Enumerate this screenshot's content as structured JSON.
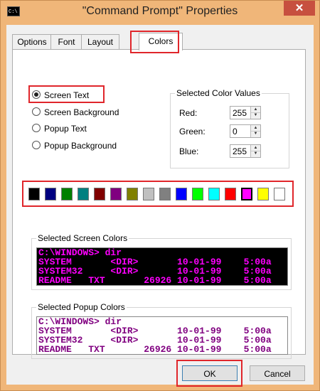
{
  "window": {
    "title": "\"Command Prompt\" Properties",
    "icon_text": "C:\\",
    "close_symbol": "✕"
  },
  "tabs": [
    {
      "label": "Options",
      "active": false
    },
    {
      "label": "Font",
      "active": false
    },
    {
      "label": "Layout",
      "active": false
    },
    {
      "label": "Colors",
      "active": true
    }
  ],
  "color_targets": {
    "selected": "Screen Text",
    "options": [
      "Screen Text",
      "Screen Background",
      "Popup Text",
      "Popup Background"
    ]
  },
  "selected_color_values": {
    "group_title": "Selected Color Values",
    "red_label": "Red:",
    "red": "255",
    "green_label": "Green:",
    "green": "0",
    "blue_label": "Blue:",
    "blue": "255"
  },
  "palette": {
    "selected_index": 13,
    "colors": [
      "#000000",
      "#000080",
      "#008000",
      "#008080",
      "#800000",
      "#800080",
      "#808000",
      "#c0c0c0",
      "#808080",
      "#0000ff",
      "#00ff00",
      "#00ffff",
      "#ff0000",
      "#ff00ff",
      "#ffff00",
      "#ffffff"
    ]
  },
  "screen_preview": {
    "title": "Selected Screen Colors",
    "background": "#000000",
    "text_color": "#ff00ff",
    "lines": [
      "C:\\WINDOWS> dir",
      "SYSTEM       <DIR>       10-01-99    5:00a",
      "SYSTEM32     <DIR>       10-01-99    5:00a",
      "README   TXT       26926 10-01-99    5:00a"
    ]
  },
  "popup_preview": {
    "title": "Selected Popup Colors",
    "background": "#ffffff",
    "text_color": "#800080",
    "lines": [
      "C:\\WINDOWS> dir",
      "SYSTEM       <DIR>       10-01-99    5:00a",
      "SYSTEM32     <DIR>       10-01-99    5:00a",
      "README   TXT       26926 10-01-99    5:00a"
    ]
  },
  "buttons": {
    "ok": "OK",
    "cancel": "Cancel"
  },
  "highlight_color": "#e0262b"
}
